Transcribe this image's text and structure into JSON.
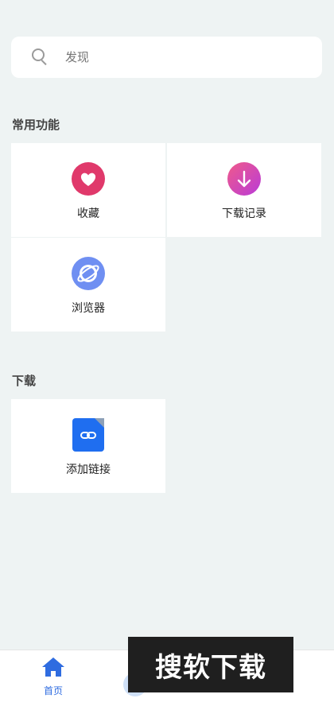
{
  "search": {
    "placeholder": "发现"
  },
  "sections": {
    "common": {
      "title": "常用功能"
    },
    "download": {
      "title": "下载"
    }
  },
  "tiles": {
    "favorites": {
      "label": "收藏",
      "icon": "heart-icon",
      "color": "#e0396b"
    },
    "download_records": {
      "label": "下载记录",
      "icon": "download-arrow-icon",
      "color": "#d84aa8"
    },
    "browser": {
      "label": "浏览器",
      "icon": "planet-icon",
      "color": "#6f8ff2"
    },
    "add_link": {
      "label": "添加链接",
      "icon": "link-file-icon",
      "color": "#1f6ef0"
    }
  },
  "tabbar": {
    "home_label": "首页",
    "accent": "#2f6ce0"
  },
  "watermark": {
    "text": "搜软下载"
  }
}
